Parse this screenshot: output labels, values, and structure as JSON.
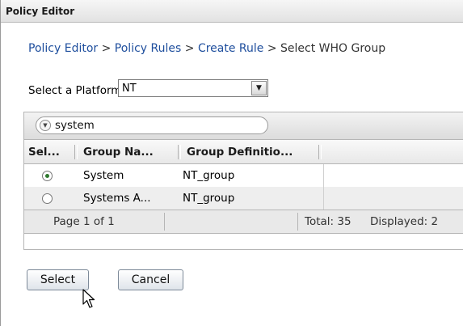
{
  "window": {
    "title": "Policy Editor"
  },
  "breadcrumb": {
    "items": [
      "Policy Editor",
      "Policy Rules",
      "Create Rule",
      "Select WHO Group"
    ],
    "separator": ">"
  },
  "platform": {
    "label": "Select a Platform:",
    "selected": "NT"
  },
  "filter": {
    "value": "system",
    "icon": "filter-dropdown-icon"
  },
  "table": {
    "columns": [
      "Sel...",
      "Group Na...",
      "Group Definitio..."
    ],
    "rows": [
      {
        "selected": true,
        "group_name": "System",
        "group_definition": "NT_group"
      },
      {
        "selected": false,
        "group_name": "Systems A...",
        "group_definition": "NT_group"
      }
    ],
    "footer": {
      "page": "Page 1 of 1",
      "total": "Total: 35",
      "displayed": "Displayed: 2"
    }
  },
  "buttons": {
    "select": "Select",
    "cancel": "Cancel"
  },
  "colors": {
    "link": "#1e4e9d",
    "radio_checked": "#2f7a2f"
  },
  "cursor": "arrow-pointer-icon"
}
